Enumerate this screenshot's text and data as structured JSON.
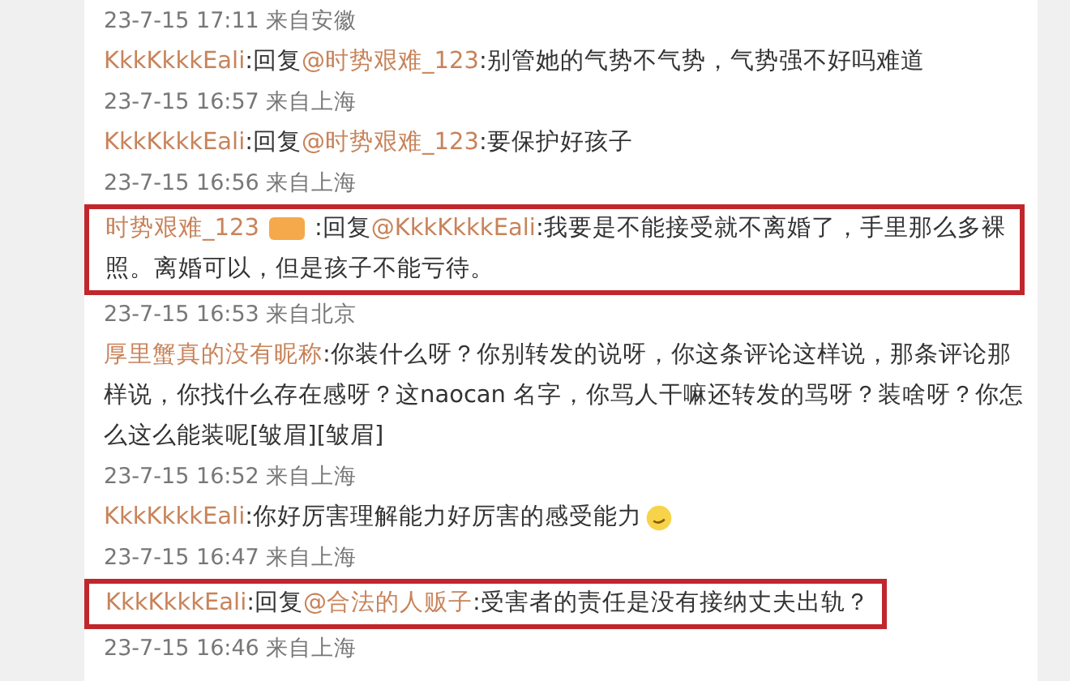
{
  "entries": [
    {
      "kind": "time",
      "text": "23-7-15 17:11 来自安徽"
    },
    {
      "kind": "comment",
      "highlighted": false,
      "user": "KkkKkkkEali",
      "prefix": ":回复",
      "mention": "@时势艰难_123",
      "body": ":别管她的气势不气势，气势强不好吗难道"
    },
    {
      "kind": "time",
      "text": "23-7-15 16:57 来自上海"
    },
    {
      "kind": "comment",
      "highlighted": false,
      "user": "KkkKkkkEali",
      "prefix": ":回复",
      "mention": "@时势艰难_123",
      "body": ":要保护好孩子"
    },
    {
      "kind": "time",
      "text": "23-7-15 16:56 来自上海"
    },
    {
      "kind": "comment",
      "highlighted": true,
      "user": "时势艰难_123",
      "badge": true,
      "prefix": ":回复",
      "mention": "@KkkKkkkEali",
      "body": ":我要是不能接受就不离婚了，手里那么多裸照。离婚可以，但是孩子不能亏待。"
    },
    {
      "kind": "time",
      "text": "23-7-15 16:53 来自北京"
    },
    {
      "kind": "comment",
      "highlighted": false,
      "user": "厚里蟹真的没有昵称",
      "body": ":你装什么呀？你别转发的说呀，你这条评论这样说，那条评论那样说，你找什么存在感呀？这naocan 名字，你骂人干嘛还转发的骂呀？装啥呀？你怎么这么能装呢[皱眉][皱眉]"
    },
    {
      "kind": "time",
      "text": "23-7-15 16:52 来自上海"
    },
    {
      "kind": "comment",
      "highlighted": false,
      "user": "KkkKkkkEali",
      "body": ":你好厉害理解能力好厉害的感受能力",
      "emoji": true
    },
    {
      "kind": "time",
      "text": "23-7-15 16:47 来自上海"
    },
    {
      "kind": "comment",
      "highlighted": true,
      "user": "KkkKkkkEali",
      "prefix": ":回复",
      "mention": "@合法的人贩子",
      "body": ":受害者的责任是没有接纳丈夫出轨？"
    },
    {
      "kind": "time",
      "text": "23-7-15 16:46 来自上海"
    }
  ]
}
